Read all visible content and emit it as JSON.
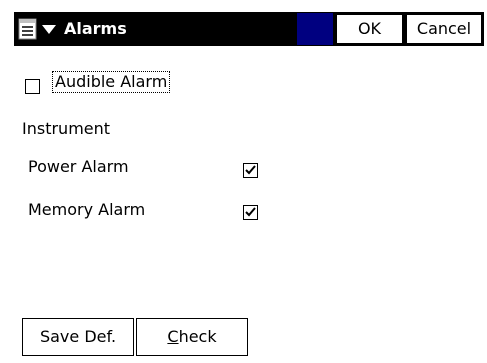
{
  "titlebar": {
    "title": "Alarms",
    "menu_icon": "start-menu-icon",
    "ok_label": "OK",
    "cancel_label": "Cancel",
    "accent_color": "#000080",
    "bar_color": "#000000"
  },
  "options": {
    "audible_alarm": {
      "label": "Audible Alarm",
      "checked": false
    }
  },
  "instrument": {
    "heading": "Instrument",
    "power_alarm": {
      "label": "Power Alarm",
      "checked": true
    },
    "memory_alarm": {
      "label": "Memory Alarm",
      "checked": true
    }
  },
  "footer": {
    "save_def_label": "Save Def.",
    "check_label_first": "C",
    "check_label_rest": "heck"
  }
}
